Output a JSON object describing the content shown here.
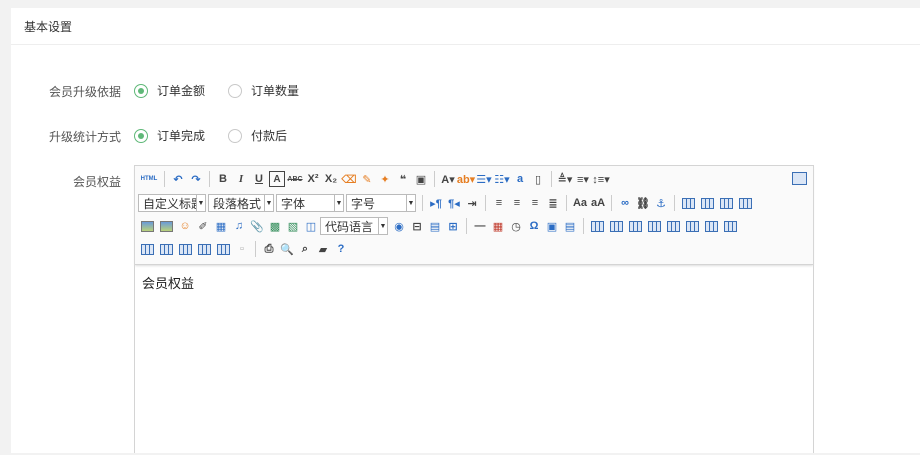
{
  "panel": {
    "title": "基本设置"
  },
  "form": {
    "upgrade_basis": {
      "label": "会员升级依据",
      "options": [
        {
          "label": "订单金额",
          "checked": true
        },
        {
          "label": "订单数量",
          "checked": false
        }
      ]
    },
    "stat_method": {
      "label": "升级统计方式",
      "options": [
        {
          "label": "订单完成",
          "checked": true
        },
        {
          "label": "付款后",
          "checked": false
        }
      ]
    },
    "benefits": {
      "label": "会员权益"
    }
  },
  "editor": {
    "content": "会员权益",
    "toolbar": {
      "html_label": "HTML",
      "custom_title": "自定义标题",
      "paragraph": "段落格式",
      "font_family": "字体",
      "font_size": "字号",
      "code_lang": "代码语言"
    }
  },
  "colors": {
    "accent": "#5fb878",
    "border": "#d4d4d4"
  }
}
